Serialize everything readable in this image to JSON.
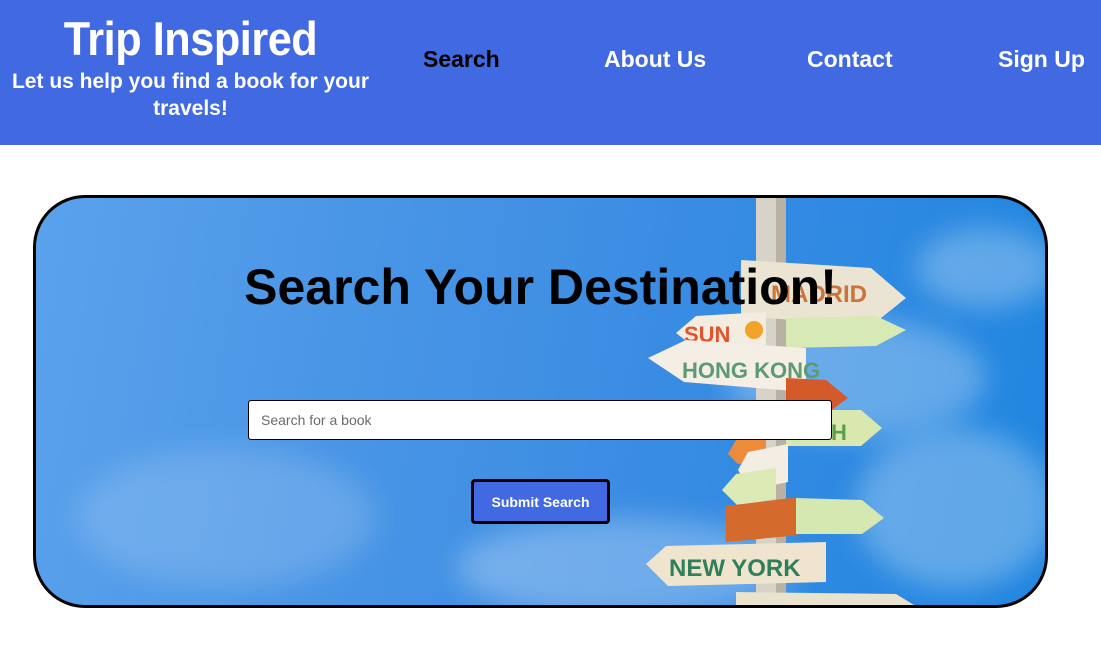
{
  "header": {
    "title": "Trip Inspired",
    "tagline": "Let us help you find a book for your travels!",
    "nav": [
      {
        "label": "Search",
        "active": true
      },
      {
        "label": "About Us",
        "active": false
      },
      {
        "label": "Contact",
        "active": false
      },
      {
        "label": "Sign Up",
        "active": false
      }
    ]
  },
  "hero": {
    "heading": "Search Your Destination!",
    "background_image": "signpost-sky-photo",
    "signs": [
      "MADRID",
      "SUN",
      "HONG KONG",
      "NEW YORK"
    ]
  },
  "search": {
    "placeholder": "Search for a book",
    "value": "",
    "submit_label": "Submit Search"
  },
  "colors": {
    "brand_blue": "#4169e1",
    "sky_blue": "#3a8ce3",
    "active_nav": "#000000",
    "nav_text": "#ffffff"
  }
}
